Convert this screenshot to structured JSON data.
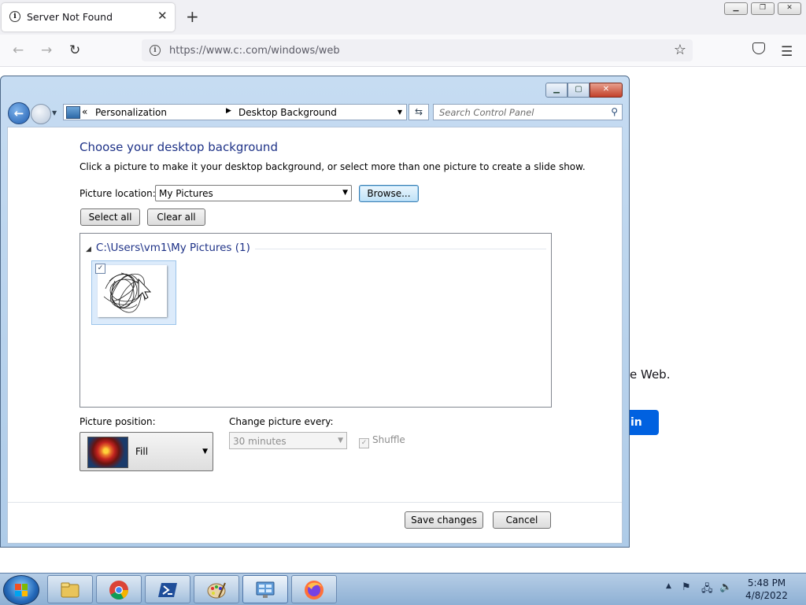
{
  "browser": {
    "tab_title": "Server Not Found",
    "url": "https://www.c:.com/windows/web",
    "bg_text_fragment": "e Web.",
    "bg_button_fragment": "in"
  },
  "window": {
    "breadcrumb": [
      "Personalization",
      "Desktop Background"
    ],
    "search_placeholder": "Search Control Panel",
    "heading": "Choose your desktop background",
    "subheading": "Click a picture to make it your desktop background, or select more than one picture to create a slide show.",
    "picture_location_label": "Picture location:",
    "picture_location_value": "My Pictures",
    "browse_label": "Browse...",
    "select_all_label": "Select all",
    "clear_all_label": "Clear all",
    "group_header": "C:\\Users\\vm1\\My Pictures (1)",
    "picture_position_label": "Picture position:",
    "picture_position_value": "Fill",
    "change_picture_label": "Change picture every:",
    "change_picture_value": "30 minutes",
    "shuffle_label": "Shuffle",
    "save_label": "Save changes",
    "cancel_label": "Cancel"
  },
  "taskbar": {
    "apps": [
      "file-explorer",
      "chrome",
      "powershell",
      "paint",
      "control-panel",
      "firefox"
    ],
    "time": "5:48 PM",
    "date": "4/8/2022"
  },
  "colors": {
    "heading": "#1e3287",
    "accent_button": "#0061e0"
  }
}
